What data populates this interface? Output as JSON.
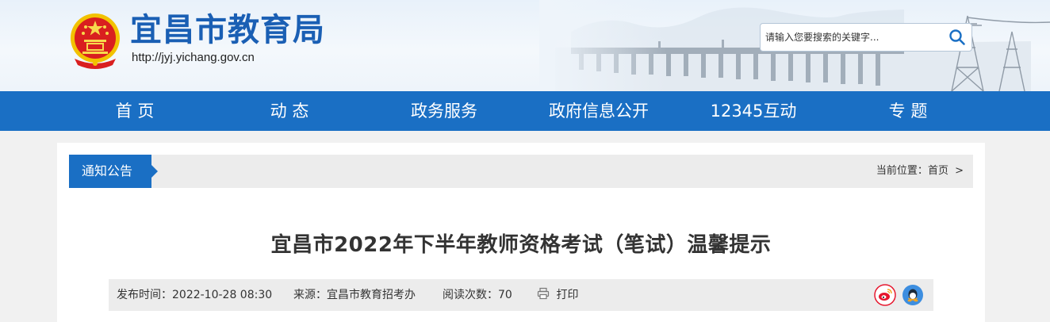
{
  "header": {
    "title": "宜昌市教育局",
    "url": "http://jyj.yichang.gov.cn",
    "search_placeholder": "请输入您要搜索的关键字..."
  },
  "nav": {
    "items": [
      {
        "label": "首 页"
      },
      {
        "label": "动 态"
      },
      {
        "label": "政务服务"
      },
      {
        "label": "政府信息公开"
      },
      {
        "label": "12345互动"
      },
      {
        "label": "专 题"
      }
    ]
  },
  "section": {
    "tag": "通知公告",
    "breadcrumb_prefix": "当前位置：",
    "breadcrumb_home": "首页",
    "breadcrumb_sep": ">"
  },
  "article": {
    "title": "宜昌市2022年下半年教师资格考试（笔试）温馨提示",
    "publish_label": "发布时间：",
    "publish_time": "2022-10-28 08:30",
    "source_label": "来源：",
    "source": "宜昌市教育招考办",
    "views_label": "阅读次数：",
    "views": "70",
    "print_label": "打印"
  },
  "colors": {
    "brand_blue": "#1a6fc4",
    "title_blue": "#1a5fb4",
    "weibo": "#e6162d",
    "qq": "#3d8ee0"
  },
  "icons": [
    "national-emblem",
    "search-icon",
    "print-icon",
    "weibo-icon",
    "qq-icon"
  ]
}
